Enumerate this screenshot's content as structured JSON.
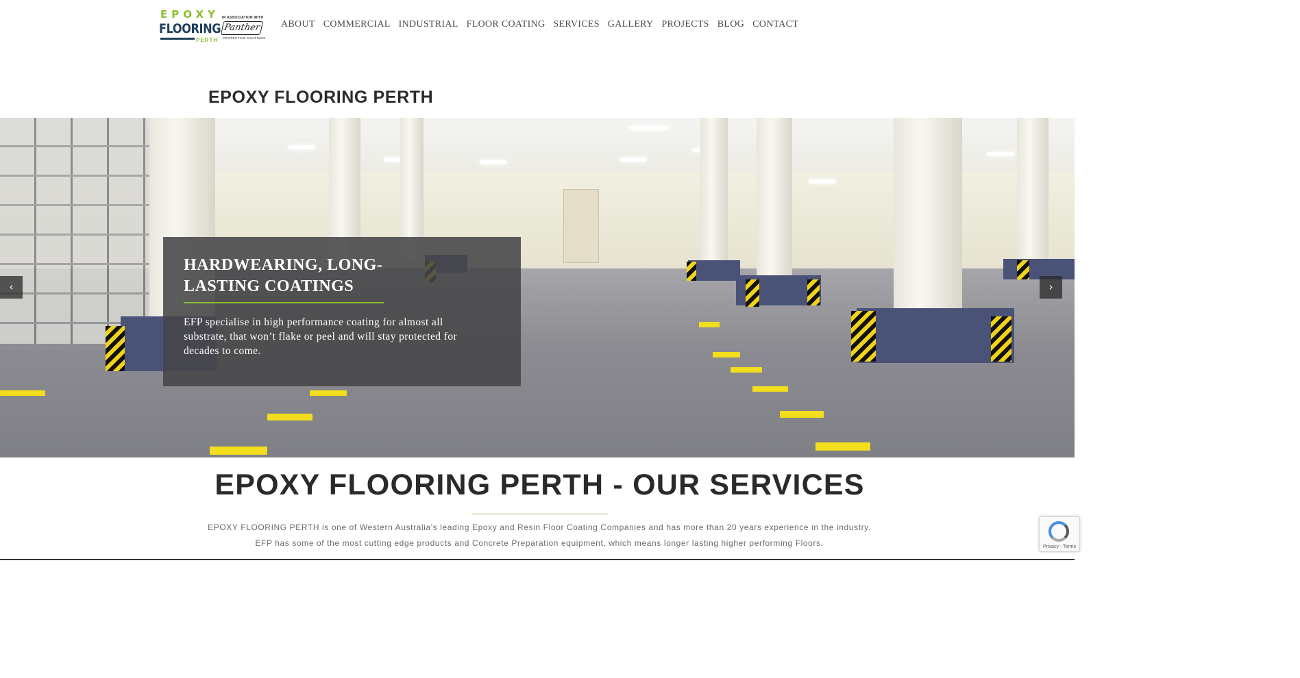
{
  "logo": {
    "word1": "EPOXY",
    "word2": "FLOORING",
    "word3": "PERTH",
    "assoc": "IN ASSOCIATION WITH",
    "partner": "Panther",
    "partner_sub": "PROTECTIVE COATINGS"
  },
  "nav": {
    "items": [
      "ABOUT",
      "COMMERCIAL",
      "INDUSTRIAL",
      "FLOOR COATING",
      "SERVICES",
      "GALLERY",
      "PROJECTS",
      "BLOG",
      "CONTACT"
    ]
  },
  "page_title": "EPOXY FLOORING PERTH",
  "hero": {
    "caption_title": "HARDWEARING, LONG-LASTING COATINGS",
    "caption_text": "EFP specialise in high performance coating for almost all substrate, that won’t flake or peel and will stay protected for decades to come.",
    "prev_icon": "‹",
    "next_icon": "›"
  },
  "services": {
    "title": "EPOXY FLOORING PERTH - OUR SERVICES",
    "line1": "EPOXY FLOORING PERTH is one of Western Australia's leading Epoxy and Resin Floor Coating Companies and has more than 20 years experience in the industry.",
    "line2": "EFP has some of the most cutting edge products and Concrete Preparation equipment, which means longer lasting higher performing Floors."
  },
  "recaptcha": {
    "links": "Privacy - Terms"
  },
  "colors": {
    "brand_green": "#8cbf2f",
    "brand_navy": "#1f3e5c"
  }
}
